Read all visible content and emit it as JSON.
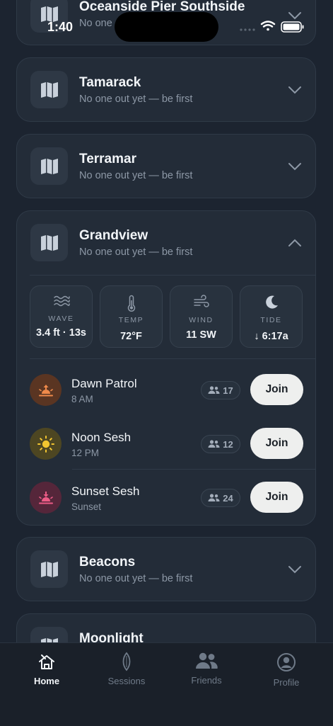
{
  "status_bar": {
    "time": "1:40"
  },
  "spots": [
    {
      "name": "Oceanside Pier Southside",
      "subtitle": "No one out yet — be first"
    },
    {
      "name": "Tamarack",
      "subtitle": "No one out yet — be first"
    },
    {
      "name": "Terramar",
      "subtitle": "No one out yet — be first"
    },
    {
      "name": "Grandview",
      "subtitle": "No one out yet — be first"
    },
    {
      "name": "Beacons",
      "subtitle": "No one out yet — be first"
    },
    {
      "name": "Moonlight",
      "subtitle": ""
    }
  ],
  "status_truncated_sub": "No one",
  "conditions": [
    {
      "label": "WAVE",
      "value": "3.4 ft · 13s",
      "icon": "waves-icon"
    },
    {
      "label": "TEMP",
      "value": "72°F",
      "icon": "thermometer-icon"
    },
    {
      "label": "WIND",
      "value": "11 SW",
      "icon": "wind-icon"
    },
    {
      "label": "TIDE",
      "value": "↓ 6:17a",
      "icon": "moon-icon"
    }
  ],
  "sessions": [
    {
      "name": "Dawn Patrol",
      "time": "8 AM",
      "count": "17",
      "join": "Join",
      "icon": "sunrise-icon",
      "color": "#f08a4b"
    },
    {
      "name": "Noon Sesh",
      "time": "12 PM",
      "count": "12",
      "join": "Join",
      "icon": "sun-icon",
      "color": "#f2c530"
    },
    {
      "name": "Sunset Sesh",
      "time": "Sunset",
      "count": "24",
      "join": "Join",
      "icon": "sunset-icon",
      "color": "#ec5c86"
    }
  ],
  "tabs": [
    {
      "label": "Home",
      "icon": "home-icon",
      "active": true
    },
    {
      "label": "Sessions",
      "icon": "surfboard-icon",
      "active": false
    },
    {
      "label": "Friends",
      "icon": "friends-icon",
      "active": false
    },
    {
      "label": "Profile",
      "icon": "profile-icon",
      "active": false
    }
  ]
}
